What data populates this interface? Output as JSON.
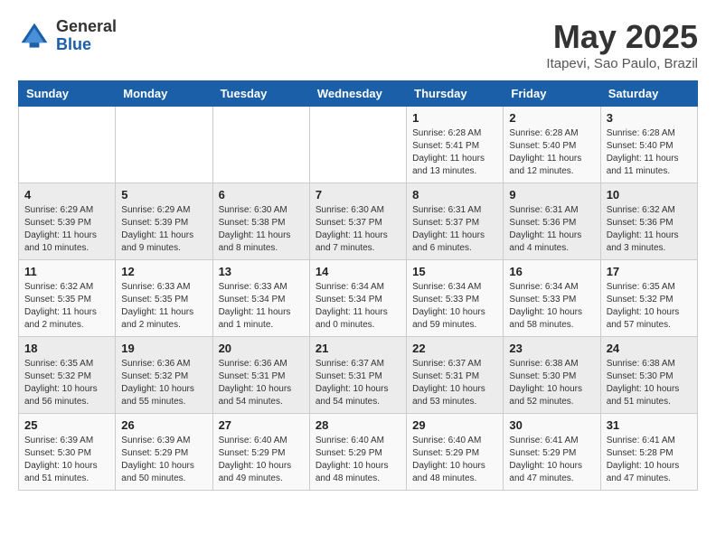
{
  "header": {
    "logo_general": "General",
    "logo_blue": "Blue",
    "month_title": "May 2025",
    "location": "Itapevi, Sao Paulo, Brazil"
  },
  "days_of_week": [
    "Sunday",
    "Monday",
    "Tuesday",
    "Wednesday",
    "Thursday",
    "Friday",
    "Saturday"
  ],
  "weeks": [
    [
      {
        "day": "",
        "info": ""
      },
      {
        "day": "",
        "info": ""
      },
      {
        "day": "",
        "info": ""
      },
      {
        "day": "",
        "info": ""
      },
      {
        "day": "1",
        "info": "Sunrise: 6:28 AM\nSunset: 5:41 PM\nDaylight: 11 hours\nand 13 minutes."
      },
      {
        "day": "2",
        "info": "Sunrise: 6:28 AM\nSunset: 5:40 PM\nDaylight: 11 hours\nand 12 minutes."
      },
      {
        "day": "3",
        "info": "Sunrise: 6:28 AM\nSunset: 5:40 PM\nDaylight: 11 hours\nand 11 minutes."
      }
    ],
    [
      {
        "day": "4",
        "info": "Sunrise: 6:29 AM\nSunset: 5:39 PM\nDaylight: 11 hours\nand 10 minutes."
      },
      {
        "day": "5",
        "info": "Sunrise: 6:29 AM\nSunset: 5:39 PM\nDaylight: 11 hours\nand 9 minutes."
      },
      {
        "day": "6",
        "info": "Sunrise: 6:30 AM\nSunset: 5:38 PM\nDaylight: 11 hours\nand 8 minutes."
      },
      {
        "day": "7",
        "info": "Sunrise: 6:30 AM\nSunset: 5:37 PM\nDaylight: 11 hours\nand 7 minutes."
      },
      {
        "day": "8",
        "info": "Sunrise: 6:31 AM\nSunset: 5:37 PM\nDaylight: 11 hours\nand 6 minutes."
      },
      {
        "day": "9",
        "info": "Sunrise: 6:31 AM\nSunset: 5:36 PM\nDaylight: 11 hours\nand 4 minutes."
      },
      {
        "day": "10",
        "info": "Sunrise: 6:32 AM\nSunset: 5:36 PM\nDaylight: 11 hours\nand 3 minutes."
      }
    ],
    [
      {
        "day": "11",
        "info": "Sunrise: 6:32 AM\nSunset: 5:35 PM\nDaylight: 11 hours\nand 2 minutes."
      },
      {
        "day": "12",
        "info": "Sunrise: 6:33 AM\nSunset: 5:35 PM\nDaylight: 11 hours\nand 2 minutes."
      },
      {
        "day": "13",
        "info": "Sunrise: 6:33 AM\nSunset: 5:34 PM\nDaylight: 11 hours\nand 1 minute."
      },
      {
        "day": "14",
        "info": "Sunrise: 6:34 AM\nSunset: 5:34 PM\nDaylight: 11 hours\nand 0 minutes."
      },
      {
        "day": "15",
        "info": "Sunrise: 6:34 AM\nSunset: 5:33 PM\nDaylight: 10 hours\nand 59 minutes."
      },
      {
        "day": "16",
        "info": "Sunrise: 6:34 AM\nSunset: 5:33 PM\nDaylight: 10 hours\nand 58 minutes."
      },
      {
        "day": "17",
        "info": "Sunrise: 6:35 AM\nSunset: 5:32 PM\nDaylight: 10 hours\nand 57 minutes."
      }
    ],
    [
      {
        "day": "18",
        "info": "Sunrise: 6:35 AM\nSunset: 5:32 PM\nDaylight: 10 hours\nand 56 minutes."
      },
      {
        "day": "19",
        "info": "Sunrise: 6:36 AM\nSunset: 5:32 PM\nDaylight: 10 hours\nand 55 minutes."
      },
      {
        "day": "20",
        "info": "Sunrise: 6:36 AM\nSunset: 5:31 PM\nDaylight: 10 hours\nand 54 minutes."
      },
      {
        "day": "21",
        "info": "Sunrise: 6:37 AM\nSunset: 5:31 PM\nDaylight: 10 hours\nand 54 minutes."
      },
      {
        "day": "22",
        "info": "Sunrise: 6:37 AM\nSunset: 5:31 PM\nDaylight: 10 hours\nand 53 minutes."
      },
      {
        "day": "23",
        "info": "Sunrise: 6:38 AM\nSunset: 5:30 PM\nDaylight: 10 hours\nand 52 minutes."
      },
      {
        "day": "24",
        "info": "Sunrise: 6:38 AM\nSunset: 5:30 PM\nDaylight: 10 hours\nand 51 minutes."
      }
    ],
    [
      {
        "day": "25",
        "info": "Sunrise: 6:39 AM\nSunset: 5:30 PM\nDaylight: 10 hours\nand 51 minutes."
      },
      {
        "day": "26",
        "info": "Sunrise: 6:39 AM\nSunset: 5:29 PM\nDaylight: 10 hours\nand 50 minutes."
      },
      {
        "day": "27",
        "info": "Sunrise: 6:40 AM\nSunset: 5:29 PM\nDaylight: 10 hours\nand 49 minutes."
      },
      {
        "day": "28",
        "info": "Sunrise: 6:40 AM\nSunset: 5:29 PM\nDaylight: 10 hours\nand 48 minutes."
      },
      {
        "day": "29",
        "info": "Sunrise: 6:40 AM\nSunset: 5:29 PM\nDaylight: 10 hours\nand 48 minutes."
      },
      {
        "day": "30",
        "info": "Sunrise: 6:41 AM\nSunset: 5:29 PM\nDaylight: 10 hours\nand 47 minutes."
      },
      {
        "day": "31",
        "info": "Sunrise: 6:41 AM\nSunset: 5:28 PM\nDaylight: 10 hours\nand 47 minutes."
      }
    ]
  ]
}
